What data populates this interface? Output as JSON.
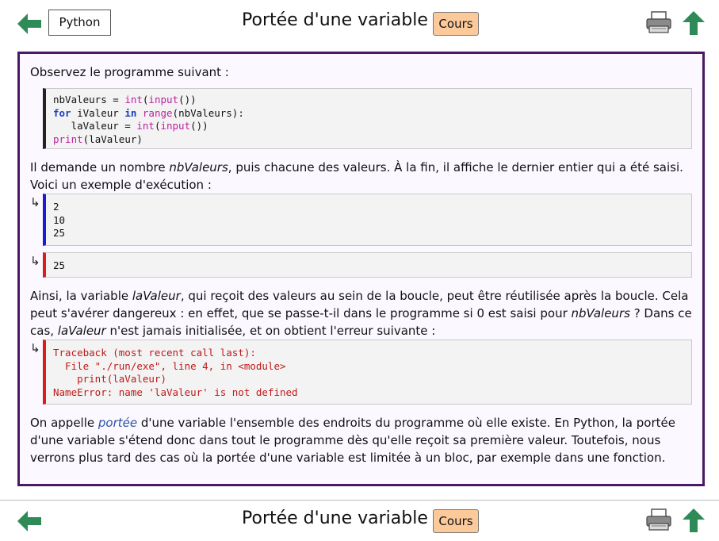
{
  "header": {
    "language_button": "Python",
    "title": "Portée d'une variable",
    "badge": "Cours"
  },
  "footer": {
    "title": "Portée d'une variable",
    "badge": "Cours"
  },
  "icons": {
    "back": "arrow-left-icon",
    "print": "printer-icon",
    "up": "arrow-up-icon"
  },
  "colors": {
    "arrow_green": "#2e8b57",
    "badge_bg": "#fbc99a",
    "frame": "#4b1866",
    "input_bar": "#1b1bd6",
    "output_bar": "#d81e1e",
    "error_text": "#c01818",
    "keyword": "#1a3fb8",
    "builtin": "#bd1fa0",
    "term": "#2c52a6"
  },
  "content": {
    "intro": "Observez le programme suivant :",
    "code": {
      "line1_a": "nbValeurs = ",
      "line1_int": "int",
      "line1_b": "(",
      "line1_input": "input",
      "line1_c": "())",
      "line2_for": "for",
      "line2_a": " iValeur ",
      "line2_in": "in",
      "line2_b": " ",
      "line2_range": "range",
      "line2_c": "(nbValeurs):",
      "line3_a": "   laValeur = ",
      "line3_int": "int",
      "line3_b": "(",
      "line3_input": "input",
      "line3_c": "())",
      "line4_print": "print",
      "line4_a": "(laValeur)"
    },
    "para2_a": "Il demande un nombre ",
    "para2_em": "nbValeurs",
    "para2_b": ", puis chacune des valeurs. À la fin, il affiche le dernier entier qui a été saisi. Voici un exemple d'exécution :",
    "arrow_symbol": "↳",
    "input_lines": [
      "2",
      "10",
      "25"
    ],
    "output_line": "25",
    "para3_a": "Ainsi, la variable ",
    "para3_em1": "laValeur",
    "para3_b": ", qui reçoit des valeurs au sein de la boucle, peut être réutilisée après la boucle. Cela peut s'avérer dangereux : en effet, que se passe-t-il dans le programme si 0 est saisi pour ",
    "para3_em2": "nbValeurs",
    "para3_c": " ? Dans ce cas, ",
    "para3_em3": "laValeur",
    "para3_d": " n'est jamais initialisée, et on obtient l'erreur suivante :",
    "error_lines": [
      "Traceback (most recent call last):",
      "  File \"./run/exe\", line 4, in <module>",
      "    print(laValeur)",
      "NameError: name 'laValeur' is not defined"
    ],
    "para4_a": "On appelle ",
    "para4_term": "portée",
    "para4_b": " d'une variable l'ensemble des endroits du programme où elle existe. En Python, la portée d'une variable s'étend donc dans tout le programme dès qu'elle reçoit sa première valeur. Toutefois, nous verrons plus tard des cas où la portée d'une variable est limitée à un bloc, par exemple dans une fonction."
  }
}
